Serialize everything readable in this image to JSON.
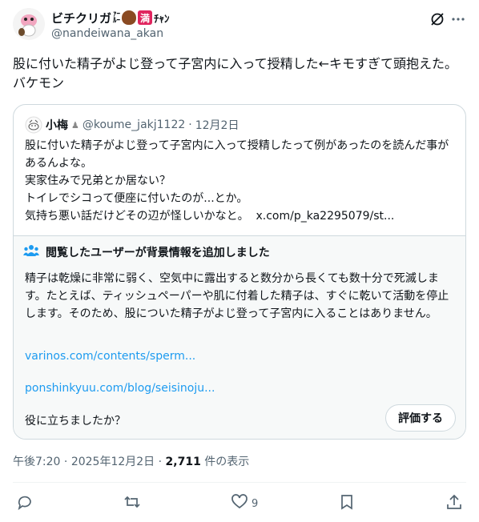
{
  "author": {
    "display_name": "ビチクリガ",
    "name_tiny_1": "ｧｰ",
    "name_tiny_2": "ﾙｰ",
    "name_man_emoji": "満",
    "name_suffix": "ﾁｬﾝ",
    "handle": "@nandeiwana_akan"
  },
  "tweet": {
    "text": "股に付いた精子がよじ登って子宮内に入って授精した←キモすぎて頭抱えた。バケモン"
  },
  "quote": {
    "name": "小梅",
    "handle": "@koume_jakj1122",
    "separator": "·",
    "date": "12月2日",
    "lines": [
      "股に付いた精子がよじ登って子宮内に入って授精したって例があったのを読んだ事があるんよな。",
      "実家住みで兄弟とか居ない？",
      "トイレでシコって便座に付いたのが...とか。",
      "気持ち悪い話だけどその辺が怪しいかなと。"
    ],
    "link": "x.com/p_ka2295079/st..."
  },
  "community_note": {
    "title": "閲覧したユーザーが背景情報を追加しました",
    "body": "精子は乾燥に非常に弱く、空気中に露出すると数分から長くても数十分で死滅します。たとえば、ティッシュペーパーや肌に付着した精子は、すぐに乾いて活動を停止します。そのため、股についた精子がよじ登って子宮内に入ることはありません。",
    "link1": "varinos.com/contents/sperm...",
    "link2": "ponshinkyuu.com/blog/seisinoju...",
    "helpful_prompt": "役に立ちましたか？",
    "rate_label": "評価する"
  },
  "meta": {
    "time": "午後7:20",
    "separator": "·",
    "date": "2025年12月2日",
    "views_count": "2,711",
    "views_label": "件の表示"
  },
  "actions": {
    "like_count": "9"
  },
  "icons": [
    "grok-icon",
    "more-icon",
    "community-note-icon",
    "reply-icon",
    "retweet-icon",
    "like-icon",
    "bookmark-icon",
    "share-icon"
  ]
}
